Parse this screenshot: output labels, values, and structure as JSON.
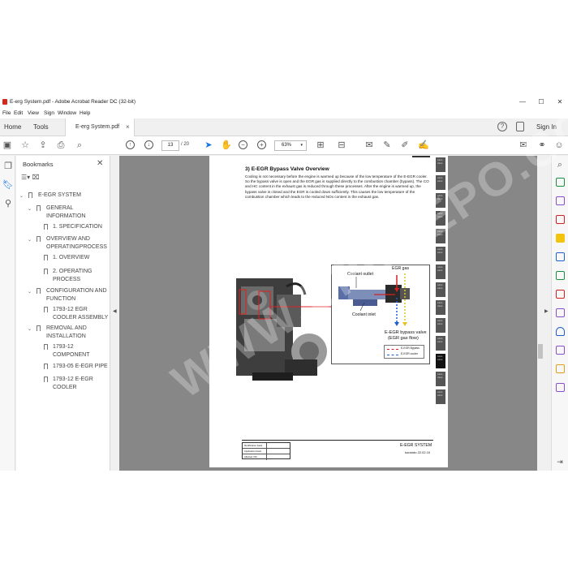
{
  "window": {
    "title": "E-erg System.pdf - Adobe Acrobat Reader DC (32-bit)",
    "minimize": "—",
    "maximize": "☐",
    "close": "✕"
  },
  "menu": [
    "File",
    "Edit",
    "View",
    "Sign",
    "Window",
    "Help"
  ],
  "tabs": {
    "home": "Home",
    "tools": "Tools",
    "document": "E-erg System.pdf",
    "close": "×",
    "help_icon": "?",
    "sign_in": "Sign In"
  },
  "toolbar": {
    "page_current": "13",
    "page_total": "/ 20",
    "zoom": "63%",
    "zoom_caret": "▾"
  },
  "bookmarks": {
    "header": "Bookmarks",
    "close": "✕",
    "items": [
      {
        "label": "E-EGR SYSTEM"
      },
      {
        "label": "GENERAL INFORMATION"
      },
      {
        "label": "1. SPECIFICATION"
      },
      {
        "label": "OVERVIEW AND OPERATINGPROCESS"
      },
      {
        "label": "1. OVERVIEW"
      },
      {
        "label": "2. OPERATING PROCESS"
      },
      {
        "label": "CONFIGURATION AND FUNCTION"
      },
      {
        "label": "1793-12 EGR COOLER ASSEMBLY"
      },
      {
        "label": "REMOVAL AND INSTALLATION"
      },
      {
        "label": "1793-12 COMPONENT"
      },
      {
        "label": "1793-05 E-EGR PIPE"
      },
      {
        "label": "1793-12 E-EGR COOLER"
      }
    ]
  },
  "page": {
    "section_title": "3) E-EGR Bypass Valve Overview",
    "body": "Cooling is not necessary before the engine is warmed up because of the low temperature of the E-EGR cooler. So the bypass valve is open and the EGR gas is supplied directly to the combustion chamber (bypass). The CO and HC content in the exhaust gas is reduced through these processes. After the engine is warmed up, the bypass valve is closed and the EGR is cooled down sufficiently. This causes the low temperature of the combustion chamber which leads to the reduced NOx content in the exhaust gas.",
    "diagram": {
      "coolant_outlet": "Coolant outlet",
      "egr_gas": "EGR gas",
      "coolant_inlet": "Coolant inlet",
      "bypass_valve": "E-EGR bypass valve",
      "egr_gas_flow": "(EGR gas flow)",
      "legend_bypass": "E-EGR Bypass",
      "legend_cooler": "E-EGR cooler"
    },
    "footer_rows": [
      "Modification basis",
      "Application basis",
      "Affected VIN"
    ],
    "footer_title": "E-EGR SYSTEM",
    "footer_sub": "korando 22.02.10"
  },
  "watermark": "WWW.EPCDEPO.COM",
  "colors": {
    "accent": "#1473e6",
    "viewer_bg": "#878787",
    "arrow_red": "#d62020",
    "arrow_blue": "#1f5fd0",
    "arrow_yellow": "#e8c21c"
  }
}
